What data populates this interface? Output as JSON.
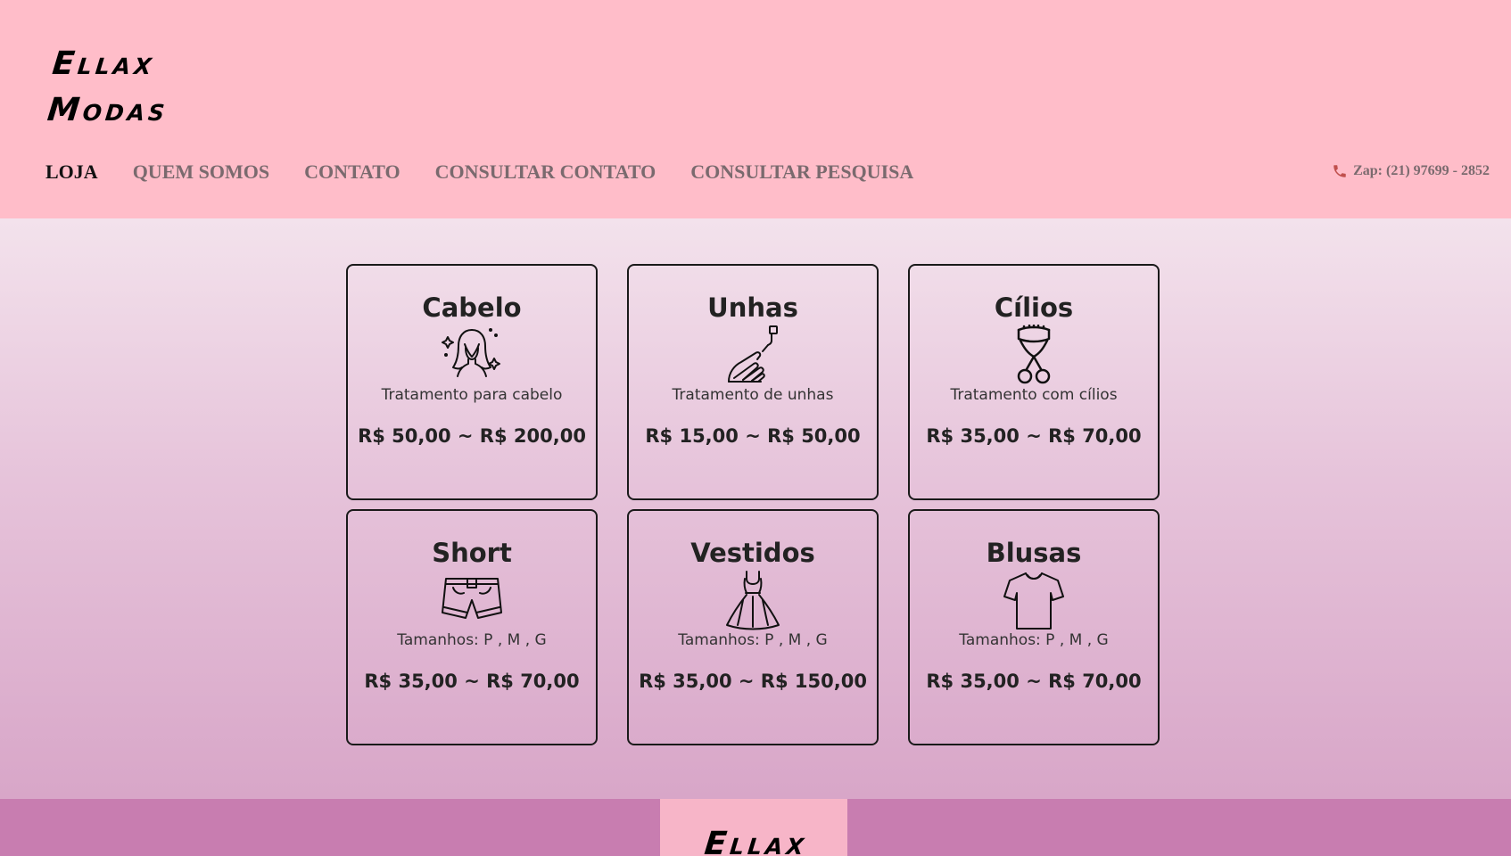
{
  "brand": {
    "line1": "Ellax",
    "line2": "Modas"
  },
  "nav": {
    "items": [
      {
        "label": "LOJA",
        "active": true
      },
      {
        "label": "QUEM SOMOS",
        "active": false
      },
      {
        "label": "CONTATO",
        "active": false
      },
      {
        "label": "CONSULTAR CONTATO",
        "active": false
      },
      {
        "label": "CONSULTAR PESQUISA",
        "active": false
      }
    ],
    "phone": "Zap: (21) 97699 - 2852",
    "phone_icon": "phone-icon"
  },
  "products": [
    {
      "title": "Cabelo",
      "icon": "hair-woman-icon",
      "desc": "Tratamento para cabelo",
      "price": "R$ 50,00 ~ R$ 200,00"
    },
    {
      "title": "Unhas",
      "icon": "nail-polish-icon",
      "desc": "Tratamento de unhas",
      "price": "R$ 15,00 ~ R$ 50,00"
    },
    {
      "title": "Cílios",
      "icon": "eyelash-curler-icon",
      "desc": "Tratamento com cílios",
      "price": "R$ 35,00 ~ R$ 70,00"
    },
    {
      "title": "Short",
      "icon": "shorts-icon",
      "desc": "Tamanhos: P , M , G",
      "price": "R$ 35,00 ~ R$ 70,00"
    },
    {
      "title": "Vestidos",
      "icon": "dress-icon",
      "desc": "Tamanhos: P , M , G",
      "price": "R$ 35,00 ~ R$ 150,00"
    },
    {
      "title": "Blusas",
      "icon": "tshirt-icon",
      "desc": "Tamanhos: P , M , G",
      "price": "R$ 35,00 ~ R$ 70,00"
    }
  ],
  "footer": {
    "brand": "Ellax"
  },
  "colors": {
    "header_bg": "#ffbdc9",
    "footer_bg": "#c87db0",
    "footer_logo_bg": "#f7b5c8",
    "nav_text": "#7a6a6e",
    "nav_active": "#111111"
  }
}
